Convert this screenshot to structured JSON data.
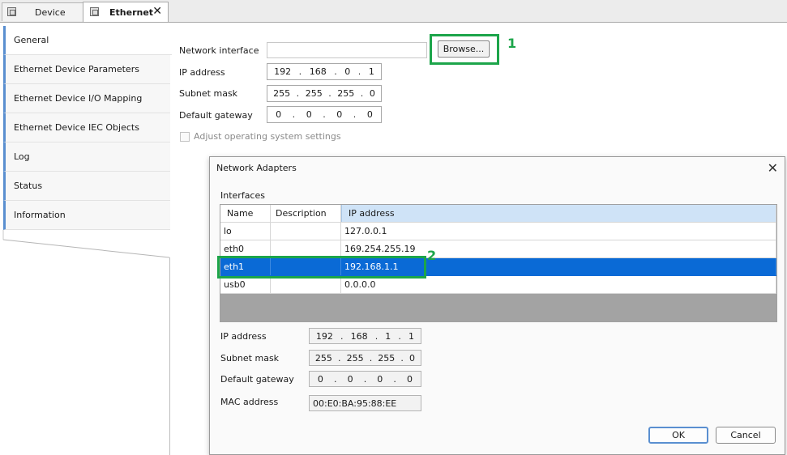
{
  "tabs": [
    {
      "label": "Device"
    },
    {
      "label": "Ethernet",
      "close": "✕"
    }
  ],
  "sidebar": {
    "items": [
      {
        "label": "General"
      },
      {
        "label": "Ethernet Device Parameters"
      },
      {
        "label": "Ethernet Device I/O Mapping"
      },
      {
        "label": "Ethernet Device IEC Objects"
      },
      {
        "label": "Log"
      },
      {
        "label": "Status"
      },
      {
        "label": "Information"
      }
    ]
  },
  "general": {
    "network_interface_label": "Network interface",
    "network_interface_value": "",
    "browse_label": "Browse...",
    "ip_label": "IP address",
    "ip": [
      "192",
      "168",
      "0",
      "1"
    ],
    "subnet_label": "Subnet mask",
    "subnet": [
      "255",
      "255",
      "255",
      "0"
    ],
    "gateway_label": "Default gateway",
    "gateway": [
      "0",
      "0",
      "0",
      "0"
    ],
    "adjust_os_label": "Adjust operating system settings"
  },
  "annotations": {
    "one": "1",
    "two": "2",
    "color": "#1ca54a"
  },
  "dialog": {
    "title": "Network Adapters",
    "close": "✕",
    "group_label": "Interfaces",
    "columns": [
      "Name",
      "Description",
      "IP address"
    ],
    "rows": [
      {
        "name": "lo",
        "description": "",
        "ip": "127.0.0.1"
      },
      {
        "name": "eth0",
        "description": "",
        "ip": "169.254.255.19"
      },
      {
        "name": "eth1",
        "description": "",
        "ip": "192.168.1.1"
      },
      {
        "name": "usb0",
        "description": "",
        "ip": "0.0.0.0"
      }
    ],
    "selected_row": "eth1",
    "selection_color": "#0a6ad6",
    "ip_label": "IP address",
    "ip": [
      "192",
      "168",
      "1",
      "1"
    ],
    "subnet_label": "Subnet mask",
    "subnet": [
      "255",
      "255",
      "255",
      "0"
    ],
    "gateway_label": "Default gateway",
    "gateway": [
      "0",
      "0",
      "0",
      "0"
    ],
    "mac_label": "MAC address",
    "mac": "00:E0:BA:95:88:EE",
    "ok_label": "OK",
    "cancel_label": "Cancel"
  }
}
